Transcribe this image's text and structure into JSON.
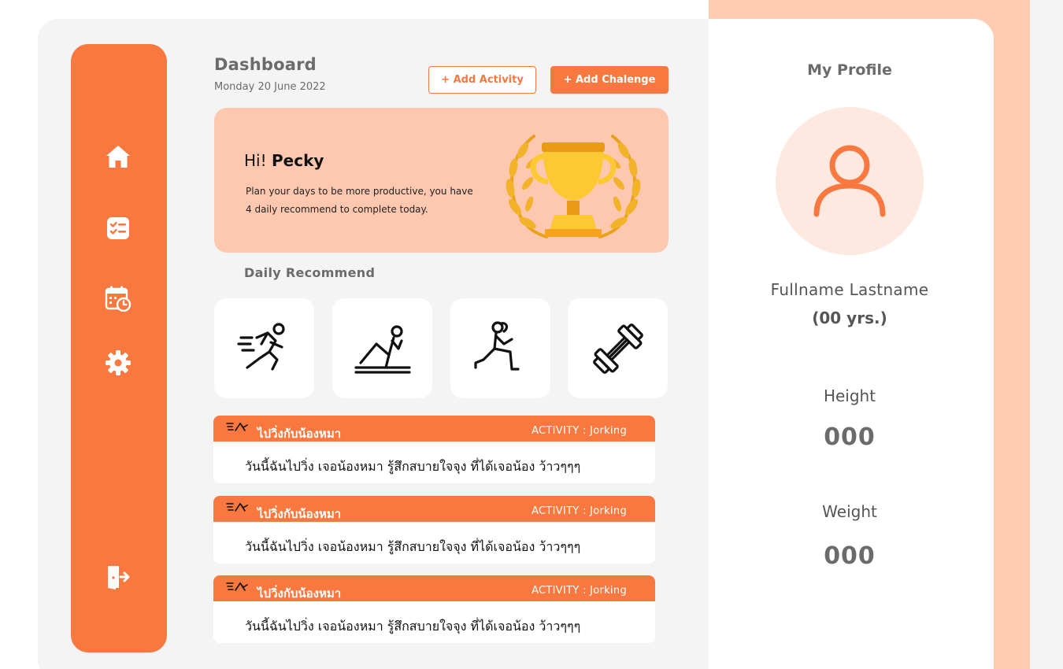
{
  "header": {
    "title": "Dashboard",
    "date": "Monday 20 June 2022",
    "add_activity_label": "+ Add Activity",
    "add_challenge_label": "+ Add Chalenge"
  },
  "sidebar": {
    "items": [
      {
        "icon": "home-icon"
      },
      {
        "icon": "checklist-icon"
      },
      {
        "icon": "calendar-clock-icon"
      },
      {
        "icon": "gear-icon"
      }
    ],
    "logout_icon": "logout-icon"
  },
  "hero": {
    "greeting": "Hi!",
    "name": "Pecky",
    "line1": "Plan your days to be more productive, you have",
    "line2": "4 daily recommend to complete today.",
    "image": "trophy-with-laurel"
  },
  "daily_recommend": {
    "title": "Daily  Recommend",
    "items": [
      {
        "icon": "running-icon"
      },
      {
        "icon": "situp-icon"
      },
      {
        "icon": "lunge-icon"
      },
      {
        "icon": "dumbbell-icon"
      }
    ]
  },
  "activities": [
    {
      "title": "ไปวิ่งกับน้องหมา",
      "type": "ACTIVITY : Jorking",
      "body": "วันนี้ฉันไปวิ่ง เจอน้องหมา รู้สึกสบายใจจุง ที่ได้เจอน้อง ว้าวๆๆๆ"
    },
    {
      "title": "ไปวิ่งกับน้องหมา",
      "type": "ACTIVITY : Jorking",
      "body": "วันนี้ฉันไปวิ่ง เจอน้องหมา รู้สึกสบายใจจุง ที่ได้เจอน้อง ว้าวๆๆๆ"
    },
    {
      "title": "ไปวิ่งกับน้องหมา",
      "type": "ACTIVITY : Jorking",
      "body": "วันนี้ฉันไปวิ่ง เจอน้องหมา รู้สึกสบายใจจุง ที่ได้เจอน้อง ว้าวๆๆๆ"
    }
  ],
  "profile": {
    "title": "My Profile",
    "fullname": "Fullname  Lastname",
    "age": "(00 yrs.)",
    "height_label": "Height",
    "height_value": "000",
    "weight_label": "Weight",
    "weight_value": "000"
  },
  "colors": {
    "accent": "#f8783f",
    "hero_bg": "#fec8b0",
    "peach_band": "#ffccb2",
    "panel_bg": "#f4f4f4",
    "text_gray": "#6b6b6b"
  }
}
